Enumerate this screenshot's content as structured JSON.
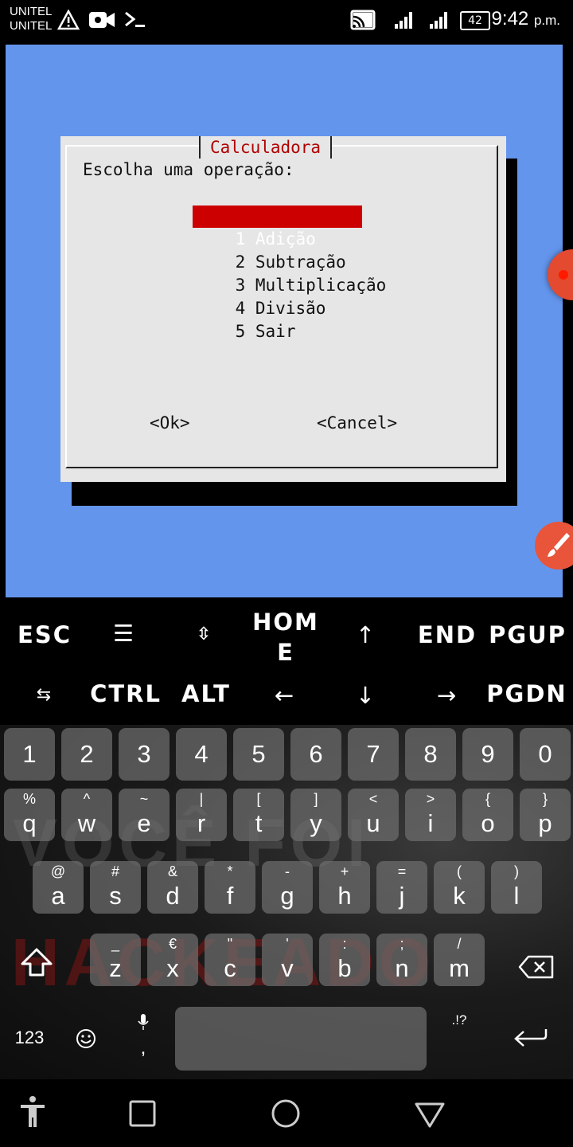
{
  "status_bar": {
    "carrier_1": "UNITEL",
    "carrier_2": "UNITEL",
    "battery": "42",
    "time": "9:42",
    "time_suffix": "p.m."
  },
  "dialog": {
    "title": "Calculadora",
    "prompt": "Escolha uma operação:",
    "items": [
      {
        "num": "1",
        "label": "Adição",
        "selected": true
      },
      {
        "num": "2",
        "label": "Subtração"
      },
      {
        "num": "3",
        "label": "Multiplicação"
      },
      {
        "num": "4",
        "label": "Divisão"
      },
      {
        "num": "5",
        "label": "Sair"
      }
    ],
    "ok_label": "<Ok>",
    "cancel_label": "<Cancel>"
  },
  "extra_keys": {
    "row1": [
      "ESC",
      "☰",
      "⇳",
      "HOM\nE",
      "↑",
      "END",
      "PGUP"
    ],
    "row2": [
      "⇆",
      "CTRL",
      "ALT",
      "←",
      "↓",
      "→",
      "PGDN"
    ]
  },
  "keyboard": {
    "numbers": [
      "1",
      "2",
      "3",
      "4",
      "5",
      "6",
      "7",
      "8",
      "9",
      "0"
    ],
    "row_q": [
      {
        "m": "q",
        "s": "%"
      },
      {
        "m": "w",
        "s": "^"
      },
      {
        "m": "e",
        "s": "~"
      },
      {
        "m": "r",
        "s": "|"
      },
      {
        "m": "t",
        "s": "["
      },
      {
        "m": "y",
        "s": "]"
      },
      {
        "m": "u",
        "s": "<"
      },
      {
        "m": "i",
        "s": ">"
      },
      {
        "m": "o",
        "s": "{"
      },
      {
        "m": "p",
        "s": "}"
      }
    ],
    "row_a": [
      {
        "m": "a",
        "s": "@"
      },
      {
        "m": "s",
        "s": "#"
      },
      {
        "m": "d",
        "s": "&"
      },
      {
        "m": "f",
        "s": "*"
      },
      {
        "m": "g",
        "s": "-"
      },
      {
        "m": "h",
        "s": "+"
      },
      {
        "m": "j",
        "s": "="
      },
      {
        "m": "k",
        "s": "("
      },
      {
        "m": "l",
        "s": ")"
      }
    ],
    "row_z": [
      {
        "m": "z",
        "s": "_"
      },
      {
        "m": "x",
        "s": "€"
      },
      {
        "m": "c",
        "s": "\""
      },
      {
        "m": "v",
        "s": "'"
      },
      {
        "m": "b",
        "s": ":"
      },
      {
        "m": "n",
        "s": ";"
      },
      {
        "m": "m",
        "s": "/"
      }
    ],
    "symbols_label": "123",
    "comma_label": ",",
    "punct_label": ".!?",
    "watermark_1": "VOCÊ FOI",
    "watermark_2": "HACKEADO"
  },
  "colors": {
    "terminal_bg": "#6495ed",
    "dialog_bg": "#e6e6e6",
    "title_color": "#b00000",
    "selection_bg": "#cc0000"
  }
}
